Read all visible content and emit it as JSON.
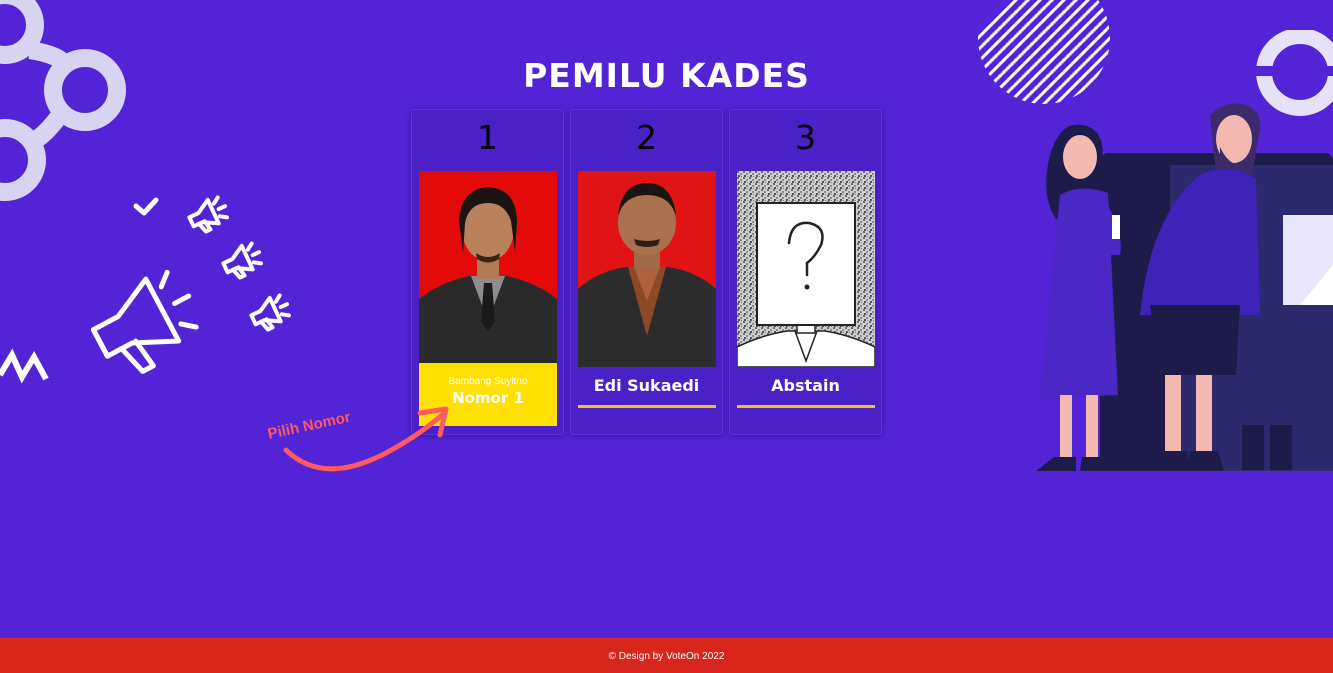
{
  "header": {
    "title": "PEMILU KADES"
  },
  "candidates": [
    {
      "number": "1",
      "name": "Bambang Suyitno",
      "selected_label": "Nomor 1",
      "photo": "candidate-photo-red-background"
    },
    {
      "number": "2",
      "name": "Edi Sukaedi",
      "photo": "candidate-photo-red-background"
    },
    {
      "number": "3",
      "name": "Abstain",
      "photo": "question-mark-placeholder"
    }
  ],
  "hint": {
    "text": "Pilih Nomor"
  },
  "footer": {
    "text": "© Design by VoteOn 2022"
  },
  "colors": {
    "background": "#5224d6",
    "footer": "#d9261c",
    "selected": "#ffe000",
    "underline": "#f0c21c",
    "photo_red": "#e30a0a",
    "hint": "#ff5a5f"
  },
  "icons": [
    "rings-decoration",
    "striped-circle-decoration",
    "megaphone-icon",
    "checkmark-icon",
    "arrow-icon",
    "voters-illustration"
  ]
}
